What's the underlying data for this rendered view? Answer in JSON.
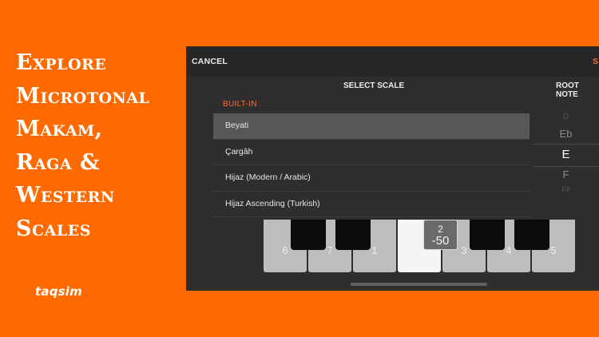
{
  "promo": {
    "lines": [
      "Explore",
      "Microtonal",
      "Makam,",
      "Raga &",
      "Western",
      "Scales"
    ]
  },
  "logo": "taqsim",
  "colors": {
    "background": "#ff6a00",
    "accent": "#ff6a35",
    "panel": "#2e2e2e"
  },
  "topbar": {
    "cancel_label": "CANCEL",
    "save_label": "S"
  },
  "headers": {
    "select_scale": "SELECT SCALE",
    "root_note": "ROOT NOTE"
  },
  "builtin_label": "BUILT-IN",
  "scales": [
    {
      "label": "Beyati",
      "selected": true
    },
    {
      "label": "Çargâh",
      "selected": false
    },
    {
      "label": "Hijaz (Modern / Arabic)",
      "selected": false
    },
    {
      "label": "Hijaz Ascending (Turkish)",
      "selected": false
    }
  ],
  "root_notes": {
    "above2": "D",
    "above1": "Eb",
    "current": "E",
    "below1": "F",
    "below2": "F#"
  },
  "keyboard": {
    "white_keys": [
      "6",
      "7",
      "1",
      "2",
      "3",
      "4",
      "5"
    ],
    "active_key": "2",
    "tooltip": {
      "degree": "2",
      "cents": "-50"
    }
  }
}
